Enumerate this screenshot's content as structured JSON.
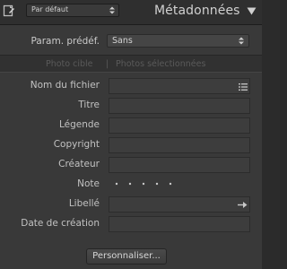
{
  "header": {
    "preset_value": "Par défaut",
    "panel_title": "Métadonnées"
  },
  "preset_row": {
    "label": "Param. prédéf.",
    "value": "Sans"
  },
  "tabs": [
    {
      "label": "Photo cible"
    },
    {
      "label": "Photos sélectionnées"
    }
  ],
  "tab_separator": "|",
  "fields": [
    {
      "label": "Nom du fichier",
      "value": ""
    },
    {
      "label": "Titre",
      "value": ""
    },
    {
      "label": "Légende",
      "value": ""
    },
    {
      "label": "Copyright",
      "value": ""
    },
    {
      "label": "Créateur",
      "value": ""
    },
    {
      "label": "Note",
      "value": ""
    },
    {
      "label": "Libellé",
      "value": ""
    },
    {
      "label": "Date de création",
      "value": ""
    }
  ],
  "rating": {
    "stars": 0,
    "max": 5
  },
  "footer": {
    "customize_label": "Personnaliser..."
  },
  "colors": {
    "panel_bg": "#393939",
    "header_bg": "#2f2f2f",
    "text": "#c2c2c2",
    "disabled_text": "#5a5a5a"
  },
  "icons": [
    "document-edit-icon",
    "select-arrows-icon",
    "collapse-triangle-icon",
    "list-icon",
    "arrow-right-icon"
  ]
}
